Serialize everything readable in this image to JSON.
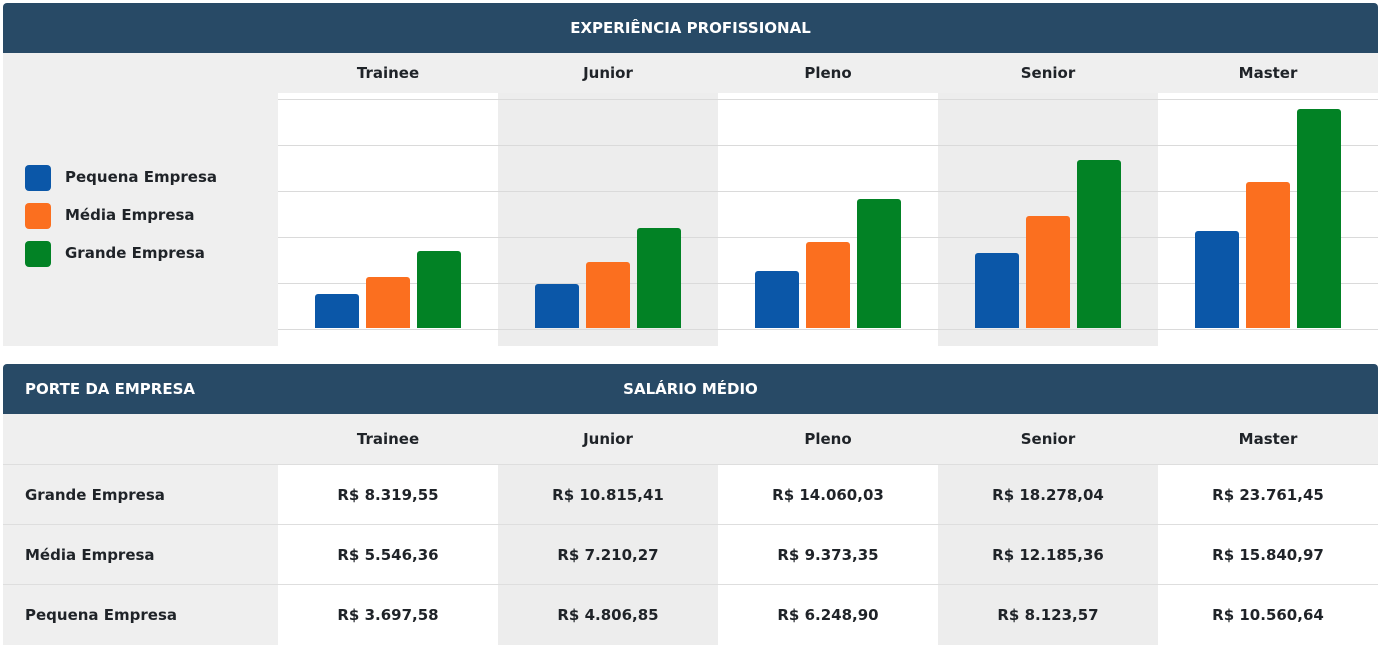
{
  "chart": {
    "title": "EXPERIÊNCIA PROFISSIONAL"
  },
  "legend": [
    {
      "label": "Pequena Empresa",
      "color": "#0b57a8"
    },
    {
      "label": "Média Empresa",
      "color": "#fb6f1f"
    },
    {
      "label": "Grande Empresa",
      "color": "#028225"
    }
  ],
  "table": {
    "left_title": "PORTE DA EMPRESA",
    "center_title": "SALÁRIO MÉDIO",
    "columns": [
      "Trainee",
      "Junior",
      "Pleno",
      "Senior",
      "Master"
    ],
    "rows": [
      {
        "label": "Grande Empresa",
        "values": [
          "R$ 8.319,55",
          "R$ 10.815,41",
          "R$ 14.060,03",
          "R$ 18.278,04",
          "R$ 23.761,45"
        ]
      },
      {
        "label": "Média Empresa",
        "values": [
          "R$ 5.546,36",
          "R$ 7.210,27",
          "R$ 9.373,35",
          "R$ 12.185,36",
          "R$ 15.840,97"
        ]
      },
      {
        "label": "Pequena Empresa",
        "values": [
          "R$ 3.697,58",
          "R$ 4.806,85",
          "R$ 6.248,90",
          "R$ 8.123,57",
          "R$ 10.560,64"
        ]
      }
    ]
  },
  "chart_data": {
    "type": "bar",
    "title": "EXPERIÊNCIA PROFISSIONAL",
    "categories": [
      "Trainee",
      "Junior",
      "Pleno",
      "Senior",
      "Master"
    ],
    "series": [
      {
        "name": "Pequena Empresa",
        "values": [
          3697.58,
          4806.85,
          6248.9,
          8123.57,
          10560.64
        ]
      },
      {
        "name": "Média Empresa",
        "values": [
          5546.36,
          7210.27,
          9373.35,
          12185.36,
          15840.97
        ]
      },
      {
        "name": "Grande Empresa",
        "values": [
          8319.55,
          10815.41,
          14060.03,
          18278.04,
          23761.45
        ]
      }
    ],
    "ylim": [
      0,
      25000
    ],
    "grid": true,
    "legend_position": "left"
  }
}
